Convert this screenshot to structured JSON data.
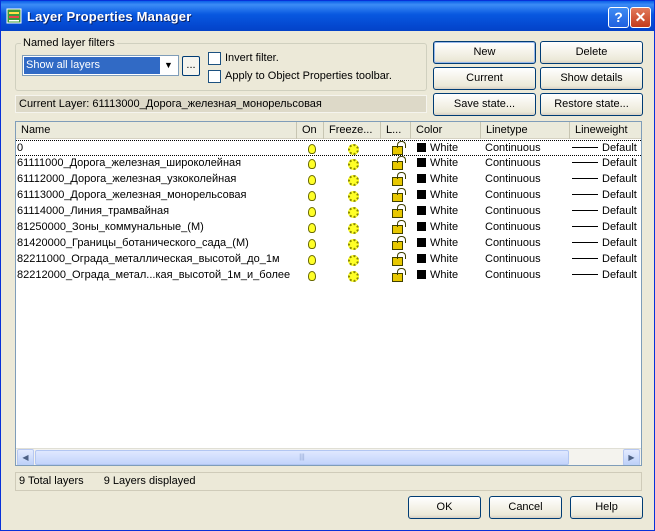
{
  "window": {
    "title": "Layer Properties Manager",
    "help_glyph": "?",
    "close_glyph": "✕"
  },
  "filters": {
    "legend": "Named layer filters",
    "selected": "Show all layers",
    "ellipsis": "...",
    "invert_label": "Invert filter.",
    "apply_label": "Apply to Object Properties toolbar."
  },
  "buttons": {
    "new": "New",
    "delete": "Delete",
    "current": "Current",
    "show_details": "Show details",
    "save_state": "Save state...",
    "restore_state": "Restore state..."
  },
  "current_layer": "Current Layer:  61113000_Дорога_железная_монорельсовая",
  "list": {
    "columns": [
      "Name",
      "On",
      "Freeze...",
      "L...",
      "Color",
      "Linetype",
      "Lineweight"
    ],
    "rows": [
      {
        "name": "0",
        "color": "White",
        "linetype": "Continuous",
        "lineweight": "Default"
      },
      {
        "name": "61111000_Дорога_железная_широколейная",
        "color": "White",
        "linetype": "Continuous",
        "lineweight": "Default"
      },
      {
        "name": "61112000_Дорога_железная_узкоколейная",
        "color": "White",
        "linetype": "Continuous",
        "lineweight": "Default"
      },
      {
        "name": "61113000_Дорога_железная_монорельсовая",
        "color": "White",
        "linetype": "Continuous",
        "lineweight": "Default"
      },
      {
        "name": "61114000_Линия_трамвайная",
        "color": "White",
        "linetype": "Continuous",
        "lineweight": "Default"
      },
      {
        "name": "81250000_Зоны_коммунальные_(M)",
        "color": "White",
        "linetype": "Continuous",
        "lineweight": "Default"
      },
      {
        "name": "81420000_Границы_ботанического_сада_(M)",
        "color": "White",
        "linetype": "Continuous",
        "lineweight": "Default"
      },
      {
        "name": "82211000_Ограда_металлическая_высотой_до_1м",
        "color": "White",
        "linetype": "Continuous",
        "lineweight": "Default"
      },
      {
        "name": "82212000_Ограда_метал...кая_высотой_1м_и_более",
        "color": "White",
        "linetype": "Continuous",
        "lineweight": "Default"
      }
    ],
    "swatch_color": "#000000"
  },
  "status": {
    "total": "9 Total layers",
    "displayed": "9 Layers displayed"
  },
  "footer": {
    "ok": "OK",
    "cancel": "Cancel",
    "help": "Help"
  },
  "colors": {
    "title_bar": "#0454e0",
    "selection": "#316ac5",
    "dialog_bg": "#ece9d8"
  }
}
